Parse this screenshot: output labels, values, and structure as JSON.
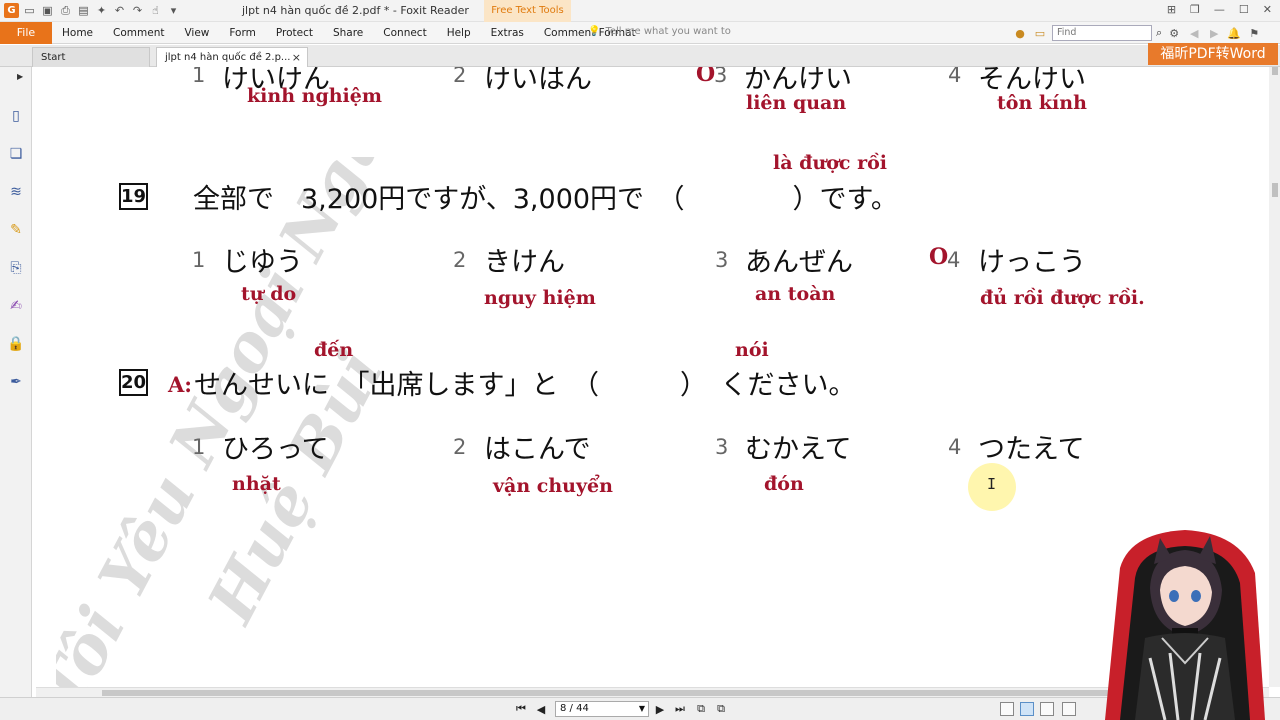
{
  "titlebar": {
    "title": "jlpt n4 hàn quốc đề 2.pdf * - Foxit Reader",
    "context_tab": "Free Text Tools"
  },
  "ribbon": {
    "file": "File",
    "tabs": [
      "Home",
      "Comment",
      "View",
      "Form",
      "Protect",
      "Share",
      "Connect",
      "Help",
      "Extras",
      "Comment Format"
    ],
    "tell_me": "Tell me what you want to",
    "find_placeholder": "Find"
  },
  "doc_tabs": {
    "start": "Start",
    "active": "jlpt n4 hàn quốc đề 2.p...",
    "close": "×"
  },
  "convert_button": "福昕PDF转Word",
  "document": {
    "prev_question": {
      "choices": [
        {
          "num": "1",
          "jp": "けいけん",
          "vn": "kinh nghiệm"
        },
        {
          "num": "2",
          "jp": "けいはん",
          "vn": ""
        },
        {
          "num": "3",
          "jp": "かんけい",
          "vn": "liên quan",
          "marked": "O"
        },
        {
          "num": "4",
          "jp": "そんけい",
          "vn": "tôn kính"
        }
      ]
    },
    "q19": {
      "number": "19",
      "annotation": "là được rồi",
      "text": "全部で　3,200円ですが、3,000円で　（　　　　）です。",
      "choices": [
        {
          "num": "1",
          "jp": "じゆう",
          "vn": "tự do"
        },
        {
          "num": "2",
          "jp": "きけん",
          "vn": "nguy hiệm"
        },
        {
          "num": "3",
          "jp": "あんぜん",
          "vn": "an toàn"
        },
        {
          "num": "4",
          "jp": "けっこう",
          "vn": "đủ rồi được rồi.",
          "marked": "O"
        }
      ]
    },
    "q20": {
      "number": "20",
      "speaker": "A:",
      "annotation_1": "đến",
      "annotation_2": "nói",
      "text": "せんせいに　「出席します」と　（　　　）　ください。",
      "choices": [
        {
          "num": "1",
          "jp": "ひろって",
          "vn": "nhặt"
        },
        {
          "num": "2",
          "jp": "はこんで",
          "vn": "vận chuyển"
        },
        {
          "num": "3",
          "jp": "むかえて",
          "vn": "đón"
        },
        {
          "num": "4",
          "jp": "つたえて",
          "vn": ""
        }
      ]
    },
    "watermark_lines": [
      "Tôi Yêu Ngoại Ngữ",
      "Huệ Bùi"
    ]
  },
  "statusbar": {
    "page_indicator": "8 / 44"
  },
  "colors": {
    "accent_orange": "#e8731a",
    "annotation_red": "#a3142c"
  }
}
